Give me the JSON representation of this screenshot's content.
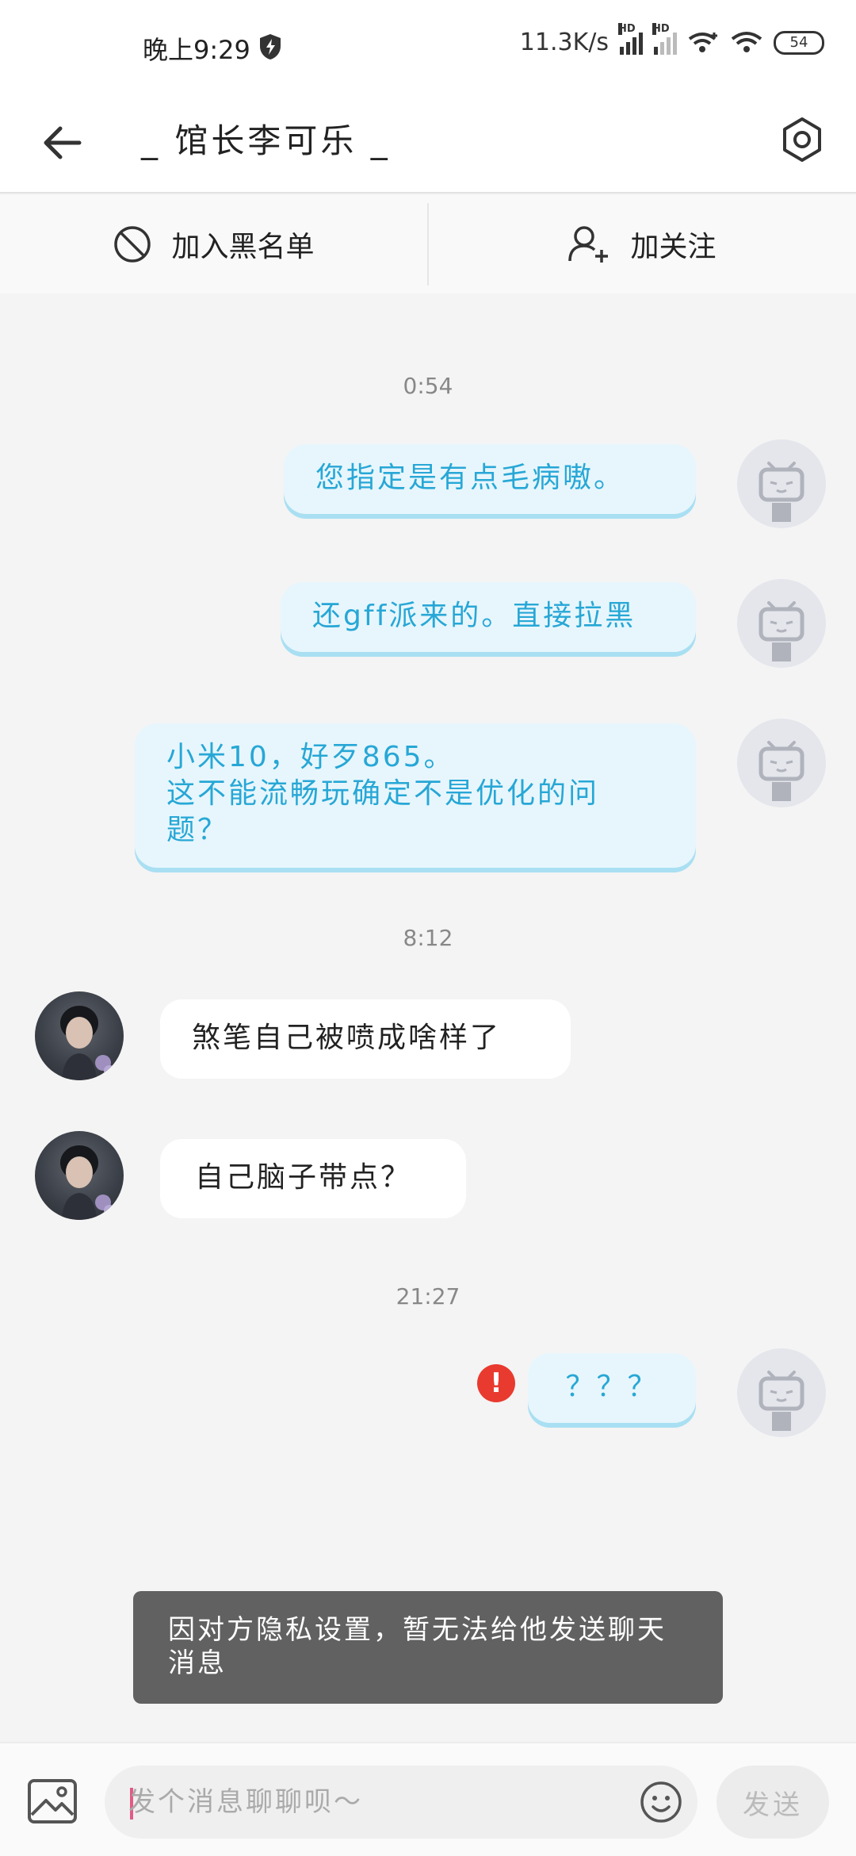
{
  "status_bar": {
    "time": "晚上9:29",
    "network_speed": "11.3K/s",
    "signal_label": "HD",
    "battery": "54"
  },
  "header": {
    "title": "_ 馆长李可乐 _"
  },
  "actions": {
    "blacklist_label": "加入黑名单",
    "follow_label": "加关注"
  },
  "timestamps": [
    "0:54",
    "8:12",
    "21:27"
  ],
  "messages": [
    {
      "sender": "me",
      "text": "您指定是有点毛病嗷。"
    },
    {
      "sender": "me",
      "text": "还gff派来的。直接拉黑"
    },
    {
      "sender": "me",
      "line1": "小米10，好歹865。",
      "line2": "这不能流畅玩确定不是优化的问",
      "line3": "题？"
    },
    {
      "sender": "them",
      "text": "煞笔自己被喷成啥样了"
    },
    {
      "sender": "them",
      "text": "自己脑子带点？"
    },
    {
      "sender": "me",
      "text": "？？？",
      "failed": true,
      "error_icon": "!"
    }
  ],
  "toast": {
    "text": "因对方隐私设置，暂无法给他发送聊天消息"
  },
  "input": {
    "placeholder": "发个消息聊聊呗～",
    "send_label": "发送"
  },
  "colors": {
    "outgoing_text": "#27a7d6",
    "outgoing_bubble": "#e7f6fc",
    "error": "#e93a2f",
    "toast_bg": "#616161"
  }
}
